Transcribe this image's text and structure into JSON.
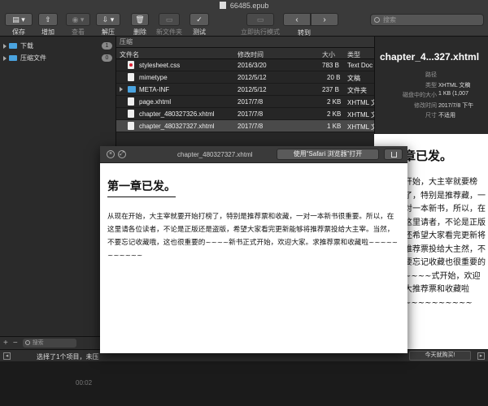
{
  "window": {
    "title": "66485.epub"
  },
  "toolbar": {
    "save": "保存",
    "add": "增加",
    "view": "查看",
    "extract": "解压",
    "delete": "删除",
    "new_folder": "新文件夹",
    "test": "测试",
    "execute_now": "立即执行模式",
    "goto": "转到",
    "search_placeholder": "搜索"
  },
  "sidebar": {
    "items": [
      {
        "label": "下载",
        "count": "1"
      },
      {
        "label": "压缩文件",
        "count": "0"
      }
    ],
    "add": "+",
    "remove": "−",
    "search_placeholder": "搜索"
  },
  "filelist": {
    "breadcrumb": "压缩",
    "columns": {
      "name": "文件名",
      "modified": "修改时间",
      "size": "大小",
      "kind": "类型"
    },
    "rows": [
      {
        "name": "stylesheet.css",
        "modified": "2016/3/20",
        "size": "783 B",
        "kind": "Text Doc",
        "icon": "css-file-icon"
      },
      {
        "name": "mimetype",
        "modified": "2012/5/12",
        "size": "20 B",
        "kind": "文稿",
        "icon": "file-icon"
      },
      {
        "name": "META-INF",
        "modified": "2012/5/12",
        "size": "237 B",
        "kind": "文件夹",
        "icon": "folder-icon"
      },
      {
        "name": "page.xhtml",
        "modified": "2017/7/8",
        "size": "2 KB",
        "kind": "XHTML 文",
        "icon": "file-icon"
      },
      {
        "name": "chapter_480327326.xhtml",
        "modified": "2017/7/8",
        "size": "2 KB",
        "kind": "XHTML 文",
        "icon": "file-icon"
      },
      {
        "name": "chapter_480327327.xhtml",
        "modified": "2017/7/8",
        "size": "1 KB",
        "kind": "XHTML 文",
        "icon": "file-icon"
      }
    ]
  },
  "inspector": {
    "title": "chapter_4...327.xhtml",
    "fields": [
      {
        "k": "路径",
        "v": ""
      },
      {
        "k": "类型",
        "v": "XHTML 文稿"
      },
      {
        "k": "磁盘中的大小",
        "v": "1 KB (1,007"
      },
      {
        "k": "修改时间",
        "v": "2017/7/8 下午"
      },
      {
        "k": "尺寸",
        "v": "不适用"
      }
    ]
  },
  "quicklook": {
    "filename": "chapter_480327327.xhtml",
    "open_button": "使用“Safari 浏览器”打开",
    "heading": "第一章已发。",
    "body": "从现在开始，大主宰就要开始打榜了，特别是推荐票和收藏，一对一本新书很重要。所以，在这里请各位读者，不论是正版还是盗版，希望大家看完更新能够将推荐票投给大主宰。当然，不要忘记收藏哦，这也很重要的~~~~新书正式开始，欢迎大家。求推荐票和收藏啦~~~~~~~~~~~"
  },
  "bgpreview": {
    "heading": "章已发。",
    "body": "开始，大主宰就要榜了，特别是推荐藏，一对一本新书，所以，在这里请者，不论是正版还希望大家看完更新将推荐票投给大主然，不要忘记收藏也很重要的~~~~式开始，欢迎大推荐票和收藏啦~~~~~~~~~~"
  },
  "statusbar": {
    "text": "选择了1个项目，未压",
    "cta": "今天就购买!"
  },
  "bottom": {
    "time": "00:02"
  }
}
